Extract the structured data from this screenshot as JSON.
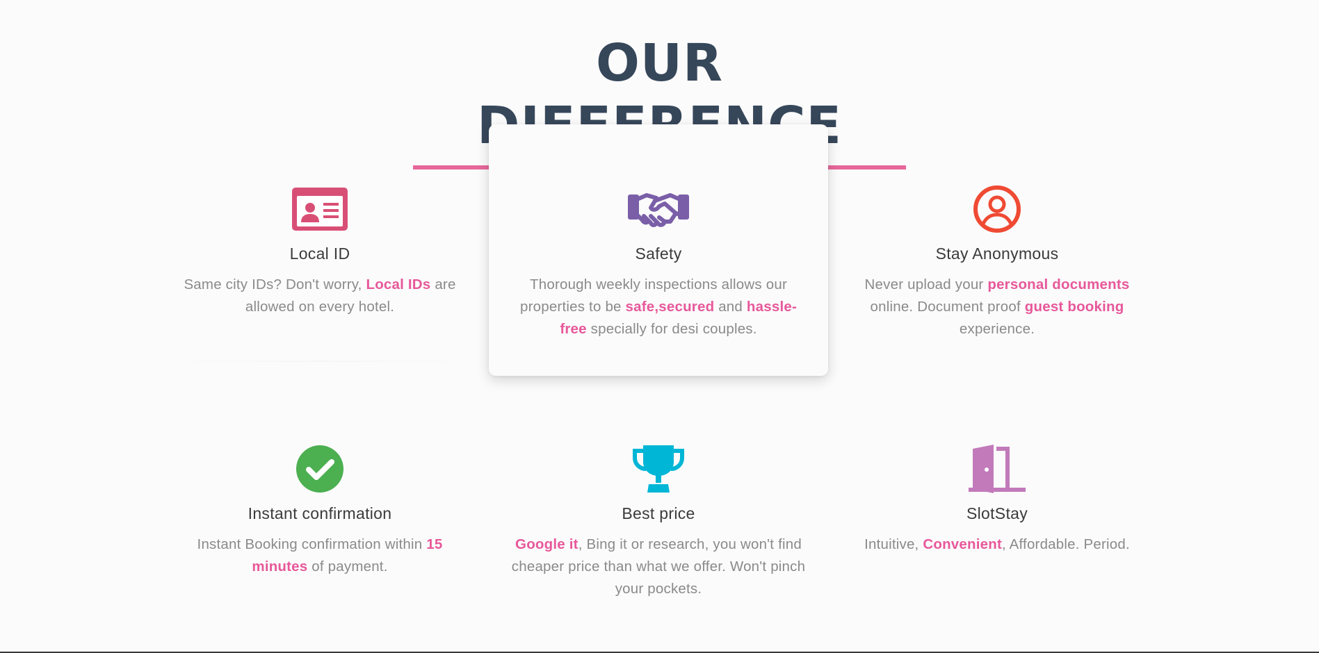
{
  "section": {
    "heading": "OUR DIFFERENCE",
    "accent_color": "#e8679a",
    "heading_color": "#37475a"
  },
  "features": [
    {
      "icon": "id-card-icon",
      "icon_color": "#d84f75",
      "title": "Local ID",
      "description": [
        {
          "text": "Same city IDs? Don't worry, ",
          "highlight": false
        },
        {
          "text": "Local IDs",
          "highlight": true
        },
        {
          "text": " are allowed on every hotel.",
          "highlight": false
        }
      ]
    },
    {
      "icon": "handshake-icon",
      "icon_color": "#7a5fa8",
      "title": "Safety",
      "description": [
        {
          "text": "Thorough weekly inspections allows our properties to be ",
          "highlight": false
        },
        {
          "text": "safe,secured",
          "highlight": true
        },
        {
          "text": " and ",
          "highlight": false
        },
        {
          "text": "hassle-free",
          "highlight": true
        },
        {
          "text": " specially for desi couples.",
          "highlight": false
        }
      ]
    },
    {
      "icon": "user-circle-icon",
      "icon_color": "#ef4a33",
      "title": "Stay Anonymous",
      "description": [
        {
          "text": "Never upload your ",
          "highlight": false
        },
        {
          "text": "personal documents",
          "highlight": true
        },
        {
          "text": " online. Document proof ",
          "highlight": false
        },
        {
          "text": "guest booking",
          "highlight": true
        },
        {
          "text": " experience.",
          "highlight": false
        }
      ]
    },
    {
      "icon": "check-circle-icon",
      "icon_color": "#4caf50",
      "title": "Instant confirmation",
      "description": [
        {
          "text": "Instant Booking confirmation within ",
          "highlight": false
        },
        {
          "text": "15 minutes",
          "highlight": true
        },
        {
          "text": " of payment.",
          "highlight": false
        }
      ]
    },
    {
      "icon": "trophy-icon",
      "icon_color": "#00b6d6",
      "title": "Best price",
      "description": [
        {
          "text": "Google it",
          "highlight": true
        },
        {
          "text": ", Bing it or research, you won't find cheaper price than what we offer. Won't pinch your pockets.",
          "highlight": false
        }
      ]
    },
    {
      "icon": "door-open-icon",
      "icon_color": "#c27abb",
      "title": "SlotStay",
      "description": [
        {
          "text": "Intuitive, ",
          "highlight": false
        },
        {
          "text": "Convenient",
          "highlight": true
        },
        {
          "text": ", Affordable. Period.",
          "highlight": false
        }
      ]
    }
  ]
}
